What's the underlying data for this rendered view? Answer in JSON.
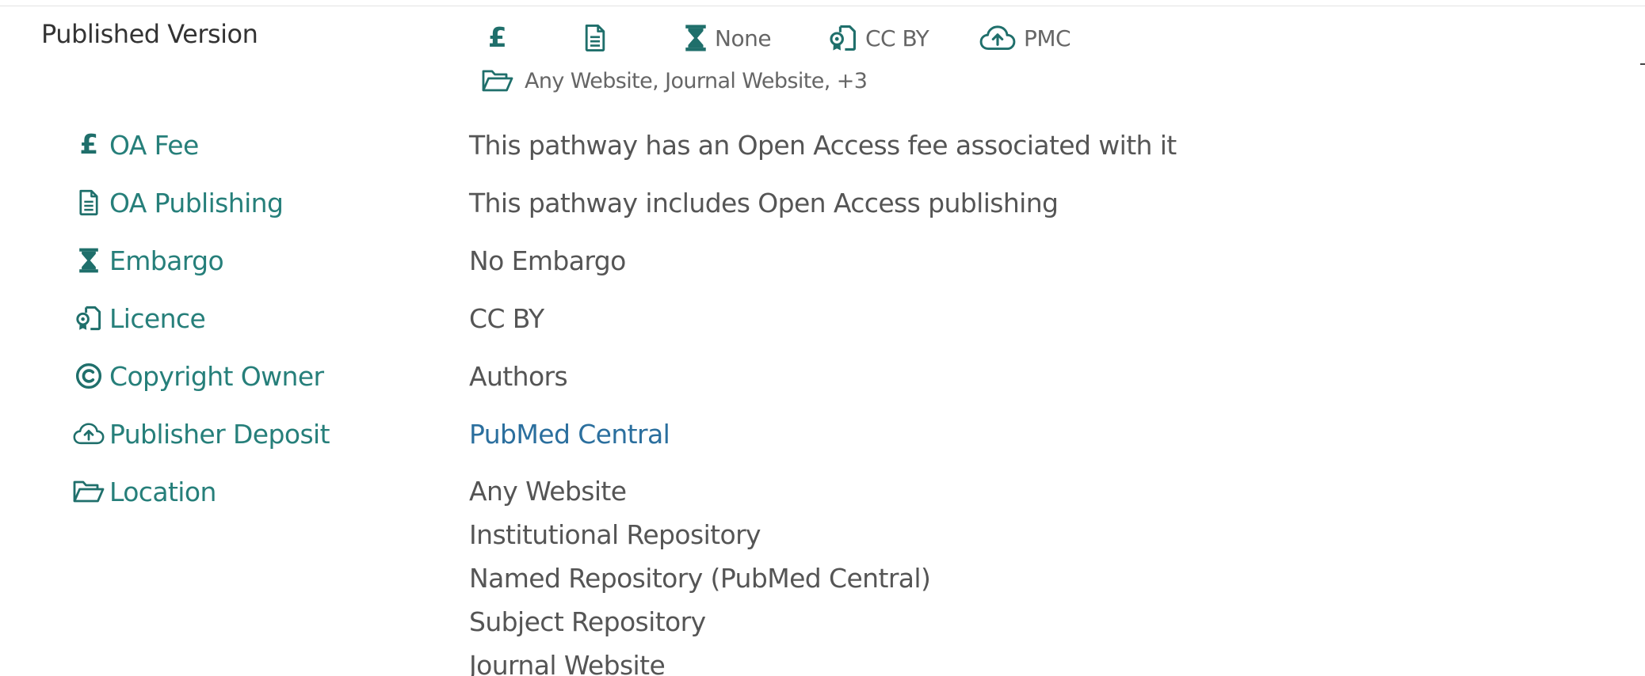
{
  "section": {
    "title": "Published Version"
  },
  "summary": {
    "fee_icon": "pound-icon",
    "publishing_icon": "document-icon",
    "embargo": {
      "icon": "hourglass-icon",
      "text": "None"
    },
    "licence": {
      "icon": "licence-icon",
      "text": "CC BY"
    },
    "deposit": {
      "icon": "cloud-upload-icon",
      "text": "PMC"
    },
    "location": {
      "icon": "folder-open-icon",
      "text": "Any Website, Journal Website, +3"
    }
  },
  "details": {
    "oa_fee": {
      "label": "OA Fee",
      "icon": "pound-icon",
      "value": "This pathway has an Open Access fee associated with it"
    },
    "oa_publishing": {
      "label": "OA Publishing",
      "icon": "document-icon",
      "value": "This pathway includes Open Access publishing"
    },
    "embargo": {
      "label": "Embargo",
      "icon": "hourglass-icon",
      "value": "No Embargo"
    },
    "licence": {
      "label": "Licence",
      "icon": "licence-icon",
      "value": "CC BY"
    },
    "copyright_owner": {
      "label": "Copyright Owner",
      "icon": "copyright-icon",
      "value": "Authors"
    },
    "publisher_deposit": {
      "label": "Publisher Deposit",
      "icon": "cloud-upload-icon",
      "value": "PubMed Central"
    },
    "location": {
      "label": "Location",
      "icon": "folder-open-icon",
      "values": [
        "Any Website",
        "Institutional Repository",
        "Named Repository (PubMed Central)",
        "Subject Repository",
        "Journal Website"
      ]
    }
  },
  "colors": {
    "accent": "#267f7a",
    "icon": "#1f6f6b",
    "text": "#555555",
    "link": "#2b6f9e"
  }
}
